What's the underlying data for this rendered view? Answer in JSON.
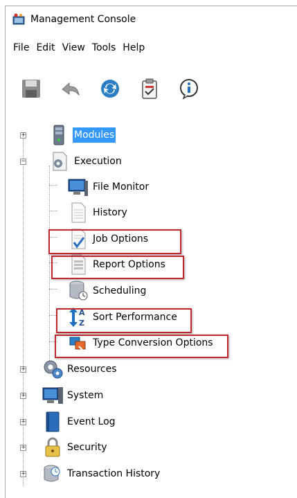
{
  "window": {
    "title": "Management Console"
  },
  "menu": [
    "File",
    "Edit",
    "View",
    "Tools",
    "Help"
  ],
  "toolbar": [
    "save-icon",
    "back-icon",
    "refresh-icon",
    "clipboard-icon",
    "info-icon"
  ],
  "tree": {
    "modules": "Modules",
    "execution": "Execution",
    "file_monitor": "File Monitor",
    "history": "History",
    "job_options": "Job Options",
    "report_options": "Report Options",
    "scheduling": "Scheduling",
    "sort_performance": "Sort Performance",
    "type_conversion": "Type Conversion Options",
    "resources": "Resources",
    "system": "System",
    "event_log": "Event Log",
    "security": "Security",
    "transaction_history": "Transaction History"
  },
  "colors": {
    "selection": "#3399ff",
    "highlight_box": "#c0272d"
  }
}
